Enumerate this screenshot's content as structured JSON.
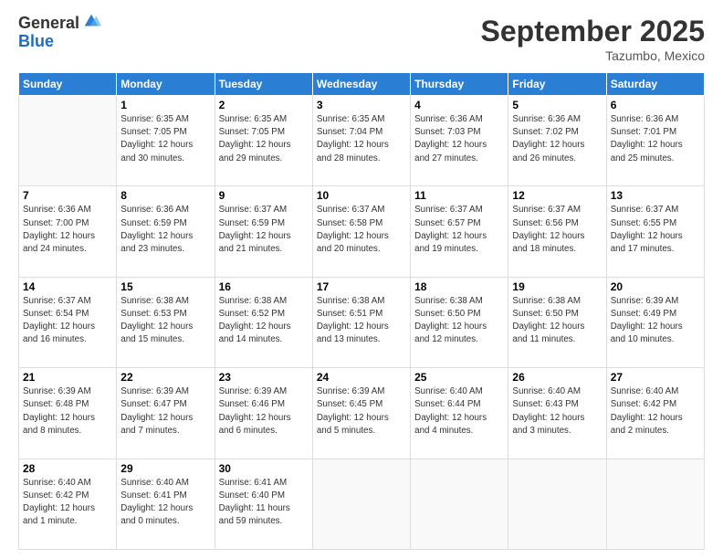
{
  "logo": {
    "general": "General",
    "blue": "Blue"
  },
  "header": {
    "month": "September 2025",
    "location": "Tazumbo, Mexico"
  },
  "weekdays": [
    "Sunday",
    "Monday",
    "Tuesday",
    "Wednesday",
    "Thursday",
    "Friday",
    "Saturday"
  ],
  "weeks": [
    [
      {
        "day": "",
        "info": ""
      },
      {
        "day": "1",
        "info": "Sunrise: 6:35 AM\nSunset: 7:05 PM\nDaylight: 12 hours\nand 30 minutes."
      },
      {
        "day": "2",
        "info": "Sunrise: 6:35 AM\nSunset: 7:05 PM\nDaylight: 12 hours\nand 29 minutes."
      },
      {
        "day": "3",
        "info": "Sunrise: 6:35 AM\nSunset: 7:04 PM\nDaylight: 12 hours\nand 28 minutes."
      },
      {
        "day": "4",
        "info": "Sunrise: 6:36 AM\nSunset: 7:03 PM\nDaylight: 12 hours\nand 27 minutes."
      },
      {
        "day": "5",
        "info": "Sunrise: 6:36 AM\nSunset: 7:02 PM\nDaylight: 12 hours\nand 26 minutes."
      },
      {
        "day": "6",
        "info": "Sunrise: 6:36 AM\nSunset: 7:01 PM\nDaylight: 12 hours\nand 25 minutes."
      }
    ],
    [
      {
        "day": "7",
        "info": "Sunrise: 6:36 AM\nSunset: 7:00 PM\nDaylight: 12 hours\nand 24 minutes."
      },
      {
        "day": "8",
        "info": "Sunrise: 6:36 AM\nSunset: 6:59 PM\nDaylight: 12 hours\nand 23 minutes."
      },
      {
        "day": "9",
        "info": "Sunrise: 6:37 AM\nSunset: 6:59 PM\nDaylight: 12 hours\nand 21 minutes."
      },
      {
        "day": "10",
        "info": "Sunrise: 6:37 AM\nSunset: 6:58 PM\nDaylight: 12 hours\nand 20 minutes."
      },
      {
        "day": "11",
        "info": "Sunrise: 6:37 AM\nSunset: 6:57 PM\nDaylight: 12 hours\nand 19 minutes."
      },
      {
        "day": "12",
        "info": "Sunrise: 6:37 AM\nSunset: 6:56 PM\nDaylight: 12 hours\nand 18 minutes."
      },
      {
        "day": "13",
        "info": "Sunrise: 6:37 AM\nSunset: 6:55 PM\nDaylight: 12 hours\nand 17 minutes."
      }
    ],
    [
      {
        "day": "14",
        "info": "Sunrise: 6:37 AM\nSunset: 6:54 PM\nDaylight: 12 hours\nand 16 minutes."
      },
      {
        "day": "15",
        "info": "Sunrise: 6:38 AM\nSunset: 6:53 PM\nDaylight: 12 hours\nand 15 minutes."
      },
      {
        "day": "16",
        "info": "Sunrise: 6:38 AM\nSunset: 6:52 PM\nDaylight: 12 hours\nand 14 minutes."
      },
      {
        "day": "17",
        "info": "Sunrise: 6:38 AM\nSunset: 6:51 PM\nDaylight: 12 hours\nand 13 minutes."
      },
      {
        "day": "18",
        "info": "Sunrise: 6:38 AM\nSunset: 6:50 PM\nDaylight: 12 hours\nand 12 minutes."
      },
      {
        "day": "19",
        "info": "Sunrise: 6:38 AM\nSunset: 6:50 PM\nDaylight: 12 hours\nand 11 minutes."
      },
      {
        "day": "20",
        "info": "Sunrise: 6:39 AM\nSunset: 6:49 PM\nDaylight: 12 hours\nand 10 minutes."
      }
    ],
    [
      {
        "day": "21",
        "info": "Sunrise: 6:39 AM\nSunset: 6:48 PM\nDaylight: 12 hours\nand 8 minutes."
      },
      {
        "day": "22",
        "info": "Sunrise: 6:39 AM\nSunset: 6:47 PM\nDaylight: 12 hours\nand 7 minutes."
      },
      {
        "day": "23",
        "info": "Sunrise: 6:39 AM\nSunset: 6:46 PM\nDaylight: 12 hours\nand 6 minutes."
      },
      {
        "day": "24",
        "info": "Sunrise: 6:39 AM\nSunset: 6:45 PM\nDaylight: 12 hours\nand 5 minutes."
      },
      {
        "day": "25",
        "info": "Sunrise: 6:40 AM\nSunset: 6:44 PM\nDaylight: 12 hours\nand 4 minutes."
      },
      {
        "day": "26",
        "info": "Sunrise: 6:40 AM\nSunset: 6:43 PM\nDaylight: 12 hours\nand 3 minutes."
      },
      {
        "day": "27",
        "info": "Sunrise: 6:40 AM\nSunset: 6:42 PM\nDaylight: 12 hours\nand 2 minutes."
      }
    ],
    [
      {
        "day": "28",
        "info": "Sunrise: 6:40 AM\nSunset: 6:42 PM\nDaylight: 12 hours\nand 1 minute."
      },
      {
        "day": "29",
        "info": "Sunrise: 6:40 AM\nSunset: 6:41 PM\nDaylight: 12 hours\nand 0 minutes."
      },
      {
        "day": "30",
        "info": "Sunrise: 6:41 AM\nSunset: 6:40 PM\nDaylight: 11 hours\nand 59 minutes."
      },
      {
        "day": "",
        "info": ""
      },
      {
        "day": "",
        "info": ""
      },
      {
        "day": "",
        "info": ""
      },
      {
        "day": "",
        "info": ""
      }
    ]
  ]
}
